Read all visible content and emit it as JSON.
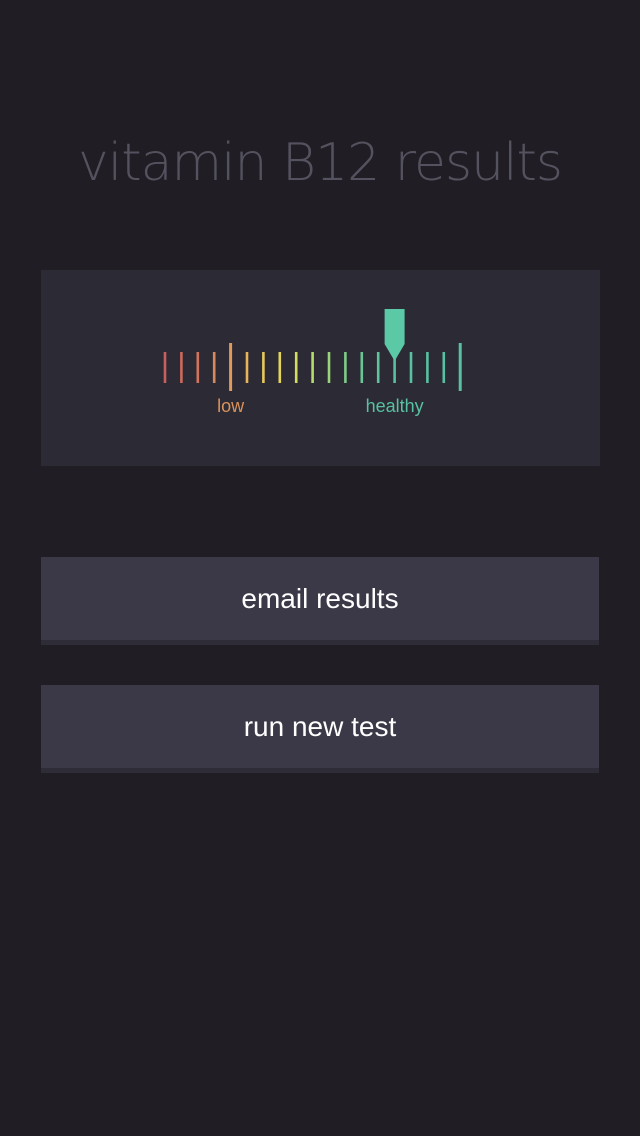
{
  "header": {
    "title": "vitamin B12 results"
  },
  "gauge": {
    "scale_labels": {
      "low": "low",
      "healthy": "healthy"
    },
    "tick_count": 19,
    "marker_tick_index": 14,
    "long_tick_indices": [
      4,
      18
    ],
    "colors": {
      "low_label": "#d9935c",
      "healthy_label": "#58c1a1",
      "marker": "#5cc9a6",
      "ticks": [
        "#c8605d",
        "#cd6a5d",
        "#d2745c",
        "#d88a5c",
        "#e09a5a",
        "#e7b45a",
        "#e8c85a",
        "#e3d55a",
        "#d3dc5e",
        "#b6dc6a",
        "#97d47a",
        "#7dcc88",
        "#6ac695",
        "#5fc39c",
        "#58c1a1",
        "#58c1a1",
        "#58c1a1",
        "#58c1a1",
        "#58c1a1"
      ]
    }
  },
  "actions": {
    "email_label": "email results",
    "run_label": "run new test"
  }
}
